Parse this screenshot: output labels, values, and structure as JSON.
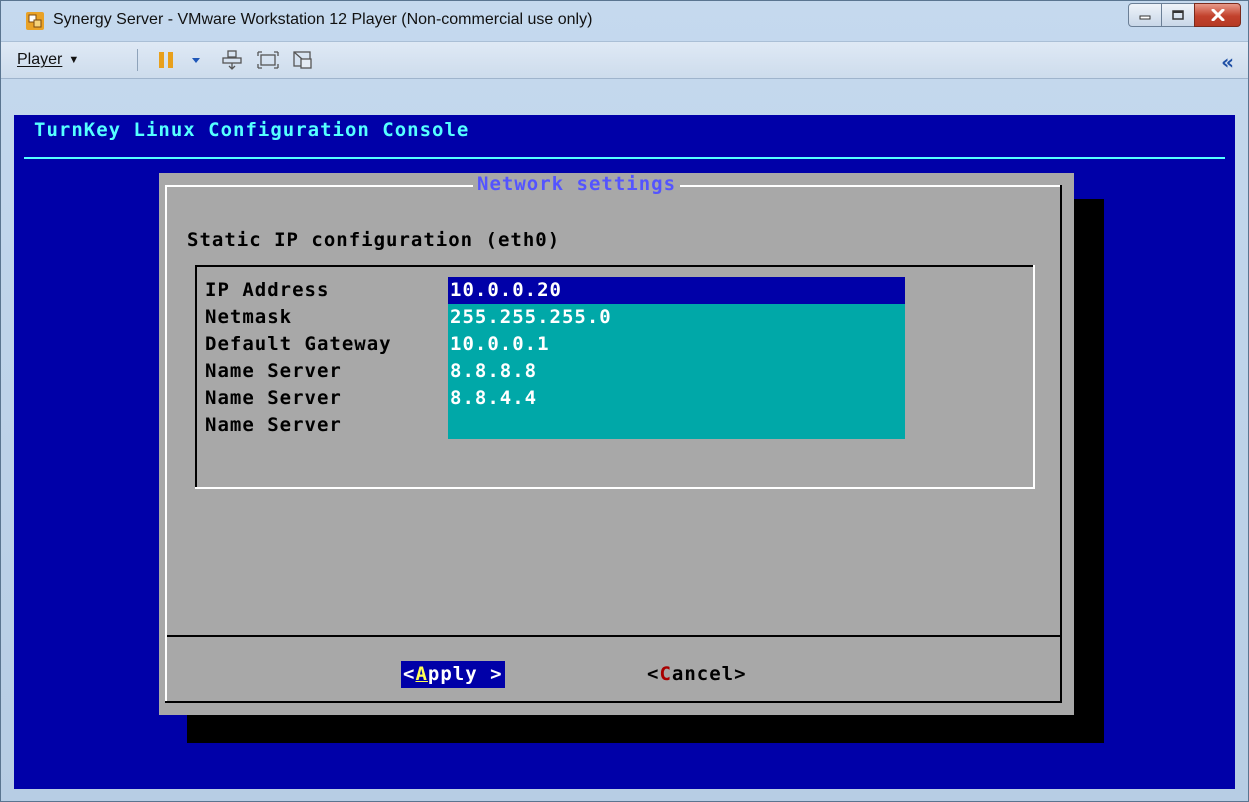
{
  "window": {
    "title": "Synergy Server - VMware Workstation 12 Player (Non-commercial use only)",
    "app_icon": "vmware-player-icon",
    "controls": [
      "minimize-icon",
      "maximize-icon",
      "close-icon"
    ]
  },
  "toolbar": {
    "player_menu_label": "Player",
    "icons": [
      "pause-icon",
      "pause-dropdown-icon",
      "send-ctrl-alt-del-icon",
      "fit-guest-icon",
      "unity-icon"
    ],
    "collapse_icon": "double-chevron-left-icon"
  },
  "console": {
    "header": "TurnKey Linux Configuration Console",
    "dialog": {
      "title": "Network settings",
      "subtitle": "Static IP configuration (eth0)",
      "fields": [
        {
          "label": "IP Address",
          "value": "10.0.0.20",
          "focused": true
        },
        {
          "label": "Netmask",
          "value": "255.255.255.0"
        },
        {
          "label": "Default Gateway",
          "value": "10.0.0.1"
        },
        {
          "label": "Name Server",
          "value": "8.8.8.8"
        },
        {
          "label": "Name Server",
          "value": "8.8.4.4"
        },
        {
          "label": "Name Server",
          "value": ""
        }
      ],
      "buttons": {
        "apply": {
          "open": "<",
          "hotkey": "A",
          "rest": "pply >"
        },
        "cancel": {
          "open": "<",
          "hotkey": "C",
          "rest": "ancel>"
        }
      }
    }
  },
  "colors": {
    "console_bg": "#0000a8",
    "console_header": "#55ffff",
    "dialog_bg": "#a8a8a8",
    "dialog_title": "#5454ff",
    "field_bg": "#00a8a8",
    "field_focus_bg": "#0000a8",
    "hotkey_apply": "#ffff55",
    "hotkey_cancel": "#a80000"
  }
}
